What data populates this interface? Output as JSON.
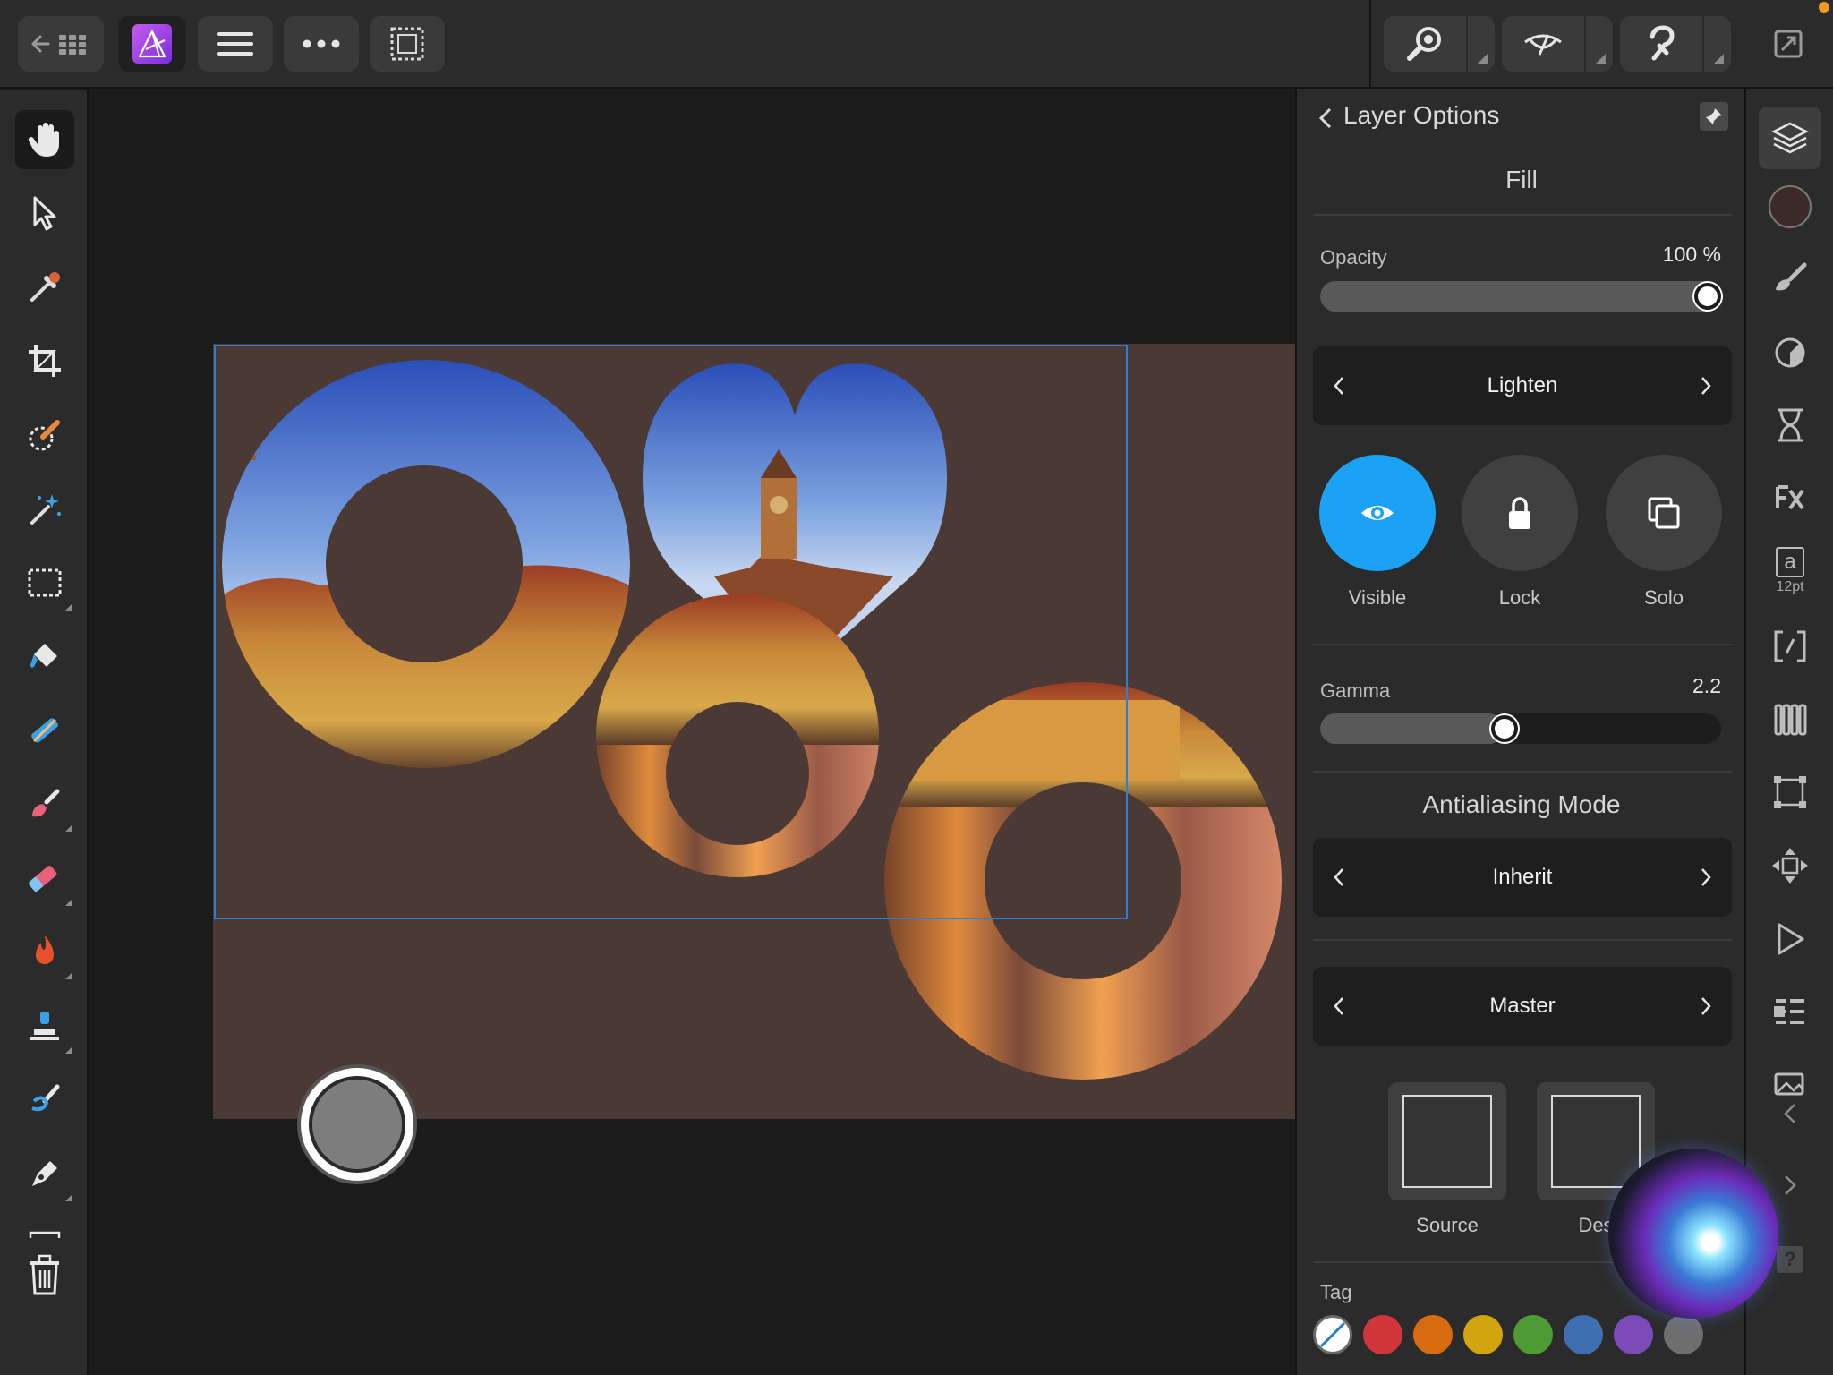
{
  "topbar": {
    "back_label": "back-to-home",
    "buttons": [
      "apps",
      "menu",
      "more",
      "selection"
    ]
  },
  "left_tools": [
    "hand",
    "move",
    "color-picker",
    "crop",
    "selection-brush",
    "flood-select",
    "marquee",
    "fill",
    "gradient",
    "paint-brush",
    "erase",
    "dodge-burn",
    "clone",
    "smudge",
    "pen",
    "delete"
  ],
  "panel": {
    "title": "Layer Options",
    "fill_section": "Fill",
    "opacity": {
      "label": "Opacity",
      "value": "100 %",
      "fraction": 1.0
    },
    "blend_mode": "Lighten",
    "visibility_buttons": [
      {
        "label": "Visible",
        "active": true
      },
      {
        "label": "Lock",
        "active": false
      },
      {
        "label": "Solo",
        "active": false
      }
    ],
    "gamma": {
      "label": "Gamma",
      "value": "2.2",
      "fraction": 0.46
    },
    "antialiasing_title": "Antialiasing Mode",
    "antialiasing_value": "Inherit",
    "channel": "Master",
    "ranges": [
      {
        "label": "Source"
      },
      {
        "label": "Des"
      }
    ],
    "tag_label": "Tag",
    "tag_colors": [
      "#ffffff",
      "#d0363a",
      "#d86b10",
      "#d2a40f",
      "#4e9a33",
      "#3f6fb0",
      "#7b4bb8",
      "#6e6e6e"
    ]
  },
  "studio": {
    "text_style_badge": "a",
    "text_style_size": "12pt",
    "swatch_color": "#3b2a28"
  },
  "colors": {
    "accent": "#1ba2f5",
    "document_bg": "#4a3935",
    "selection": "#2d7fd6"
  }
}
